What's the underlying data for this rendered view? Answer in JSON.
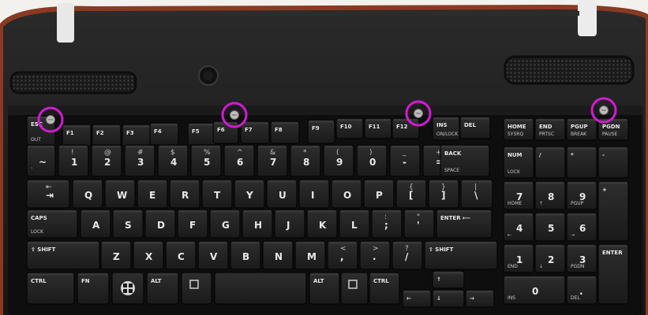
{
  "photo": {
    "subject": "laptop keyboard",
    "highlight_color": "#d11bd1",
    "highlighted_items": [
      "screw-1",
      "screw-2",
      "screw-3",
      "screw-4"
    ]
  },
  "keys": {
    "esc": "ESC",
    "esc_sub": "OUT",
    "f1": "F1",
    "f2": "F2",
    "f3": "F3",
    "f4": "F4",
    "f5": "F5",
    "f6": "F6",
    "f7": "F7",
    "f8": "F8",
    "f9": "F9",
    "f10": "F10",
    "f11": "F11",
    "f12": "F12",
    "ins": "INS",
    "ins_sub": "ON/LOCK",
    "del": "DEL",
    "home": "HOME",
    "home_sub": "SYSRQ",
    "end": "END",
    "end_sub": "PRTSC",
    "pgup": "PGUP",
    "pgup_sub": "BREAK",
    "pgdn": "PGDN",
    "pgdn_sub": "PAUSE",
    "tilde": "~",
    "tilde_sub": "`",
    "n1": "1",
    "n1_top": "!",
    "n2": "2",
    "n2_top": "@",
    "n3": "3",
    "n3_top": "#",
    "n4": "4",
    "n4_top": "$",
    "n5": "5",
    "n5_top": "%",
    "n6": "6",
    "n6_top": "^",
    "n7": "7",
    "n7_top": "&",
    "n8": "8",
    "n8_top": "*",
    "n9": "9",
    "n9_top": "(",
    "n0": "0",
    "n0_top": ")",
    "minus": "-",
    "minus_top": "_",
    "equal": "=",
    "equal_top": "+",
    "backspace_1": "BACK",
    "backspace_2": "SPACE",
    "tab": "⇥",
    "tab_top": "⇤",
    "q": "Q",
    "w": "W",
    "e": "E",
    "r": "R",
    "t": "T",
    "y": "Y",
    "u": "U",
    "i": "I",
    "o": "O",
    "p": "P",
    "lbracket": "[",
    "lbracket_top": "{",
    "rbracket": "]",
    "rbracket_top": "}",
    "backslash": "\\",
    "backslash_top": "|",
    "caps_1": "CAPS",
    "caps_2": "LOCK",
    "a": "A",
    "s": "S",
    "d": "D",
    "f": "F",
    "g": "G",
    "h": "H",
    "j": "J",
    "k": "K",
    "l": "L",
    "semicolon": ";",
    "semicolon_top": ":",
    "quote": "'",
    "quote_top": "\"",
    "enter": "ENTER ⟵",
    "lshift": "⇧ SHIFT",
    "z": "Z",
    "x": "X",
    "c": "C",
    "v": "V",
    "b": "B",
    "n": "N",
    "m": "M",
    "comma": ",",
    "comma_top": "<",
    "period": ".",
    "period_top": ">",
    "slash": "/",
    "slash_top": "?",
    "rshift": "⇧ SHIFT",
    "ctrl": "CTRL",
    "fn": "FN",
    "alt": "ALT",
    "ralt": "ALT",
    "rctrl": "CTRL",
    "numlock_1": "NUM",
    "numlock_2": "LOCK",
    "np_slash": "/",
    "np_star": "*",
    "np_minus": "-",
    "np_plus": "+",
    "np7": "7",
    "np7_sub": "HOME",
    "np8": "8",
    "np8_sub": "↑",
    "np9": "9",
    "np9_sub": "PGUP",
    "np4": "4",
    "np4_sub": "←",
    "np5": "5",
    "np6": "6",
    "np6_sub": "→",
    "np1": "1",
    "np1_sub": "END",
    "np2": "2",
    "np2_sub": "↓",
    "np3": "3",
    "np3_sub": "PGDN",
    "np0": "0",
    "np0_sub": "INS",
    "np_dot": ".",
    "np_dot_sub": "DEL",
    "np_enter": "ENTER",
    "up": "↑",
    "left": "←",
    "down": "↓",
    "right": "→"
  }
}
